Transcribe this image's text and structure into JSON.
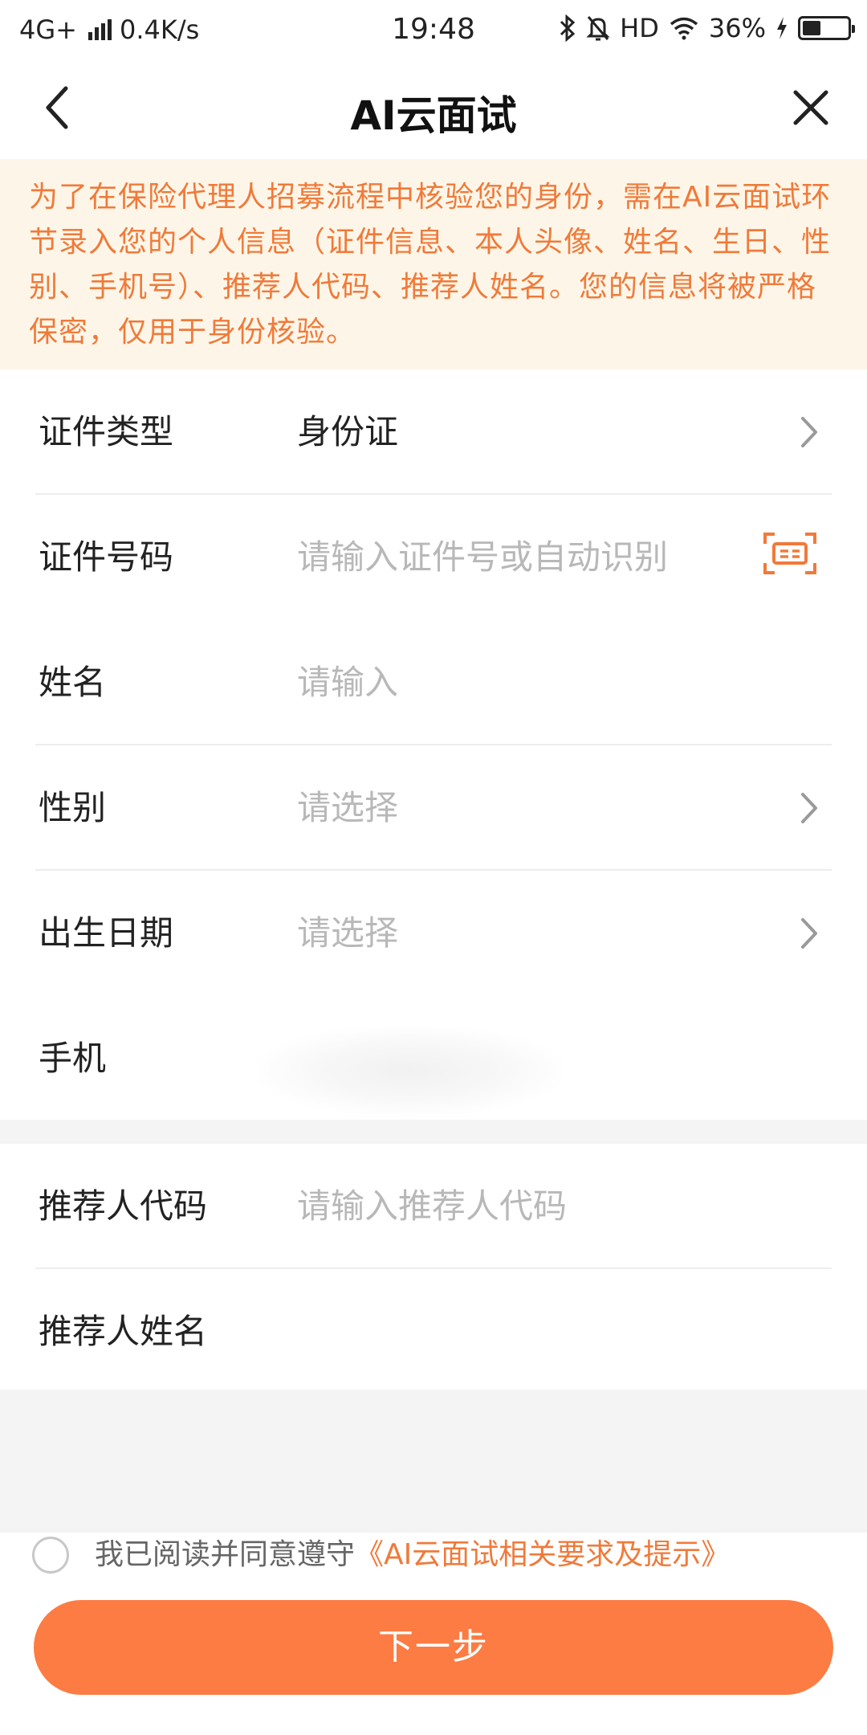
{
  "status_bar": {
    "network": "4G+",
    "speed": "0.4K/s",
    "time": "19:48",
    "hd": "HD",
    "battery": "36%"
  },
  "header": {
    "title": "AI云面试"
  },
  "notice": {
    "text": "为了在保险代理人招募流程中核验您的身份，需在AI云面试环节录入您的个人信息（证件信息、本人头像、姓名、生日、性别、手机号）、推荐人代码、推荐人姓名。您的信息将被严格保密，仅用于身份核验。"
  },
  "form": {
    "id_type": {
      "label": "证件类型",
      "value": "身份证"
    },
    "id_number": {
      "label": "证件号码",
      "placeholder": "请输入证件号或自动识别"
    },
    "name": {
      "label": "姓名",
      "placeholder": "请输入"
    },
    "gender": {
      "label": "性别",
      "placeholder": "请选择"
    },
    "birth_date": {
      "label": "出生日期",
      "placeholder": "请选择"
    },
    "phone": {
      "label": "手机"
    },
    "referrer_code": {
      "label": "推荐人代码",
      "placeholder": "请输入推荐人代码"
    },
    "referrer_name": {
      "label": "推荐人姓名"
    }
  },
  "agreement": {
    "prefix": "我已阅读并同意遵守",
    "link": "《AI云面试相关要求及提示》"
  },
  "next_button": {
    "label": "下一步"
  },
  "colors": {
    "accent": "#fd7c44",
    "notice_text": "#f07a3a",
    "notice_bg": "#fdf6e8"
  },
  "icons": [
    "back-arrow-icon",
    "close-icon",
    "chevron-right-icon",
    "id-scan-icon",
    "bluetooth-icon",
    "mute-bell-icon",
    "wifi-icon",
    "battery-icon",
    "charging-icon"
  ]
}
